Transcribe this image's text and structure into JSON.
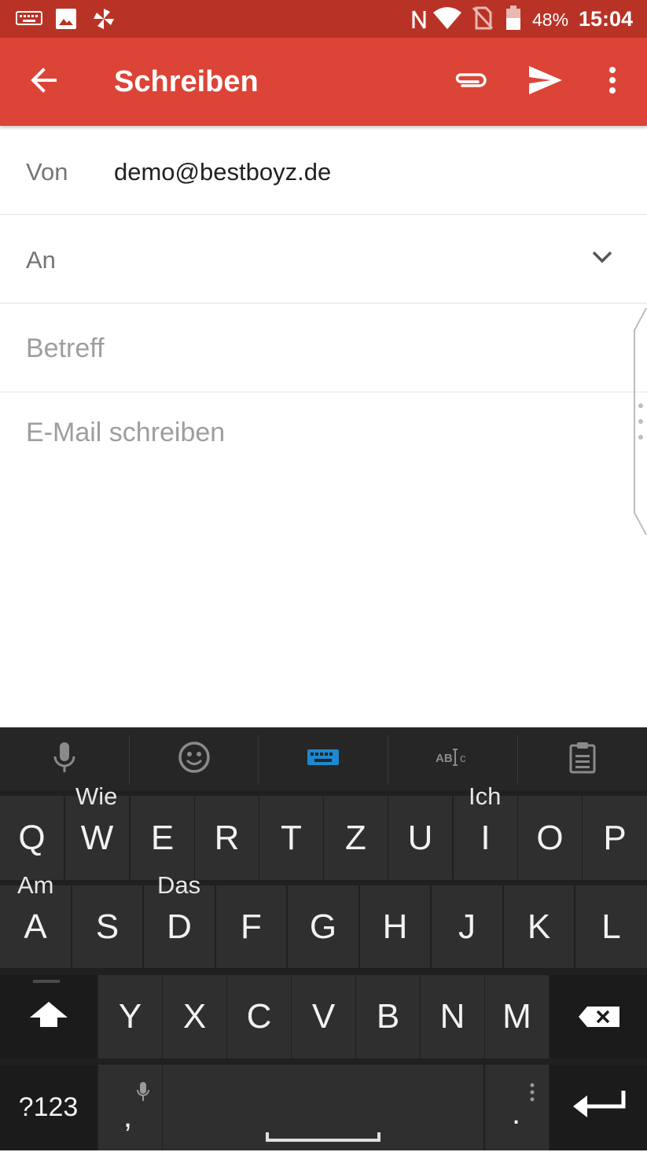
{
  "status_bar": {
    "battery": "48%",
    "time": "15:04",
    "icons": [
      "keyboard-icon",
      "image-icon",
      "pinwheel-icon",
      "nfc-icon",
      "wifi-icon",
      "no-sim-icon",
      "battery-icon"
    ]
  },
  "app_bar": {
    "title": "Schreiben",
    "icons": [
      "back-arrow-icon",
      "attachment-icon",
      "send-icon",
      "more-vert-icon"
    ],
    "color": "#db4437"
  },
  "compose": {
    "from_label": "Von",
    "from_value": "demo@bestboyz.de",
    "to_label": "An",
    "subject_placeholder": "Betreff",
    "body_placeholder": "E-Mail schreiben"
  },
  "keyboard": {
    "toolbar": [
      "microphone-icon",
      "emoji-icon",
      "keyboard-icon",
      "spellcheck-icon",
      "clipboard-icon"
    ],
    "suggestions": [
      "Wie",
      "Ich",
      "Am",
      "Das"
    ],
    "row1": [
      "Q",
      "W",
      "E",
      "R",
      "T",
      "Z",
      "U",
      "I",
      "O",
      "P"
    ],
    "row2": [
      "A",
      "S",
      "D",
      "F",
      "G",
      "H",
      "J",
      "K",
      "L"
    ],
    "row3": [
      "Y",
      "X",
      "C",
      "V",
      "B",
      "N",
      "M"
    ],
    "symbols_label": "?123",
    "comma": ",",
    "period": "."
  }
}
